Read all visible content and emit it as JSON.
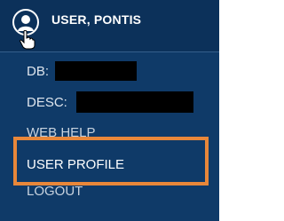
{
  "header": {
    "user_name": "USER, PONTIS",
    "avatar_icon": "user-circle-icon",
    "cursor_icon": "hand-pointer-icon"
  },
  "menu": {
    "items": [
      {
        "label": "DB: "
      },
      {
        "label": "DESC: "
      },
      {
        "label": "WEB HELP"
      },
      {
        "label": "USER PROFILE",
        "highlighted": true
      },
      {
        "label": "LOGOUT"
      }
    ]
  },
  "colors": {
    "panel_background": "#0f3a68",
    "header_background": "#0c315a",
    "highlight_border": "#e8873a",
    "redaction": "#000000"
  }
}
